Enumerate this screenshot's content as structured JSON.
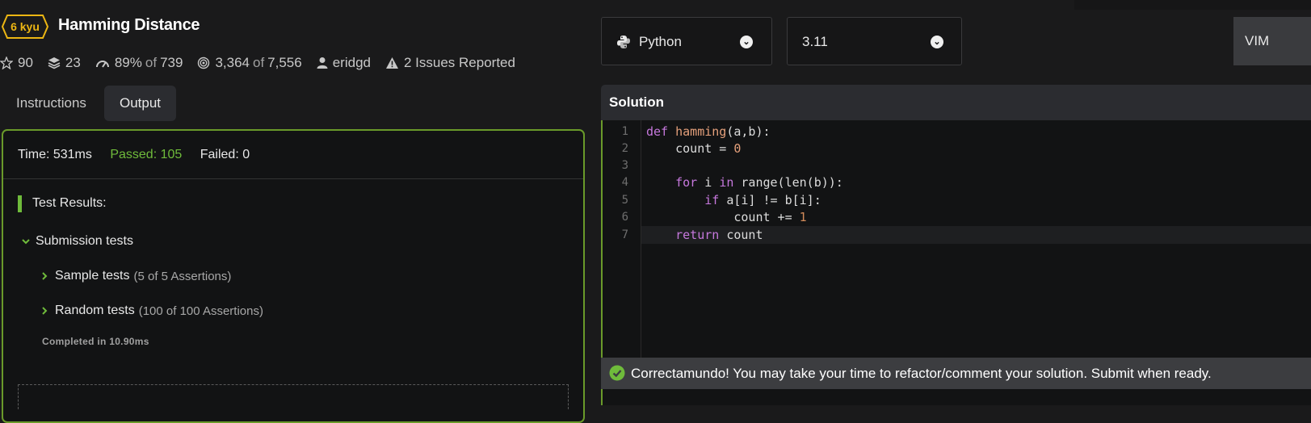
{
  "kata": {
    "rank": "6 kyu",
    "title": "Hamming Distance"
  },
  "stats": {
    "stars": "90",
    "collections": "23",
    "satisfaction": "89%",
    "satisfaction_of": "of",
    "satisfaction_votes": "739",
    "completed": "3,364",
    "completed_of": "of",
    "attempts": "7,556",
    "author": "eridgd",
    "issues": "2 Issues Reported"
  },
  "tabs": [
    {
      "label": "Instructions"
    },
    {
      "label": "Output"
    }
  ],
  "output": {
    "time": "Time: 531ms",
    "passed": "Passed: 105",
    "failed": "Failed: 0",
    "results_title": "Test Results:",
    "group": "Submission tests",
    "tests": [
      {
        "name": "Sample tests",
        "assertions": "(5 of 5 Assertions)"
      },
      {
        "name": "Random tests",
        "assertions": "(100 of 100 Assertions)"
      }
    ],
    "completed": "Completed in 10.90ms"
  },
  "editor": {
    "language": "Python",
    "version": "3.11",
    "mode_button": "VIM",
    "panel_title": "Solution",
    "line_numbers": [
      "1",
      "2",
      "3",
      "4",
      "5",
      "6",
      "7"
    ],
    "code": {
      "l1_kw": "def",
      "l1_fn": "hamming",
      "l1_rest": "(a,b):",
      "l2_a": "    count = ",
      "l2_num": "0",
      "l4_kw": "    for",
      "l4_a": " i ",
      "l4_kw2": "in",
      "l4_rest": " range(len(b)):",
      "l5_kw": "        if",
      "l5_rest": " a[i] != b[i]:",
      "l6_a": "            count += ",
      "l6_num": "1",
      "l7_kw": "    return",
      "l7_rest": " count"
    }
  },
  "status": {
    "message": "Correctamundo! You may take your time to refactor/comment your solution. Submit when ready."
  },
  "colors": {
    "accent_green": "#6fbb3b",
    "rank_yellow": "#ecb613",
    "panel_border": "#6a9a2a"
  }
}
